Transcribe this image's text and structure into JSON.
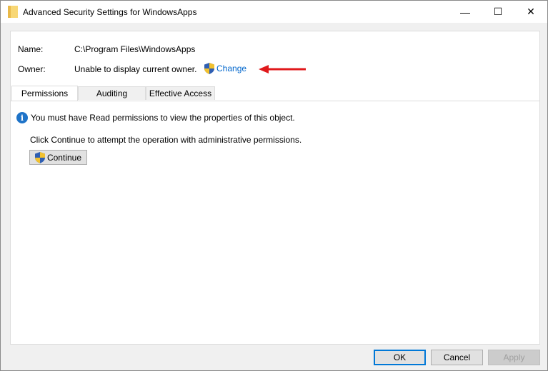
{
  "window": {
    "title": "Advanced Security Settings for WindowsApps",
    "icon": "folder-icon",
    "minimize_glyph": "—",
    "maximize_glyph": "☐",
    "close_glyph": "✕"
  },
  "details": {
    "name_label": "Name:",
    "name_value": "C:\\Program Files\\WindowsApps",
    "owner_label": "Owner:",
    "owner_value": "Unable to display current owner.",
    "change_link": "Change"
  },
  "tabs": [
    {
      "label": "Permissions",
      "active": true
    },
    {
      "label": "Auditing",
      "active": false
    },
    {
      "label": "Effective Access",
      "active": false
    }
  ],
  "permissions": {
    "info_message": "You must have Read permissions to view the properties of this object.",
    "continue_prompt": "Click Continue to attempt the operation with administrative permissions.",
    "continue_button": "Continue"
  },
  "footer": {
    "ok_label": "OK",
    "cancel_label": "Cancel",
    "apply_label": "Apply",
    "apply_enabled": false
  },
  "colors": {
    "link": "#0066cc",
    "annotation_arrow": "#e0191b",
    "info_icon": "#1e73c8",
    "default_button_border": "#0078d7"
  }
}
